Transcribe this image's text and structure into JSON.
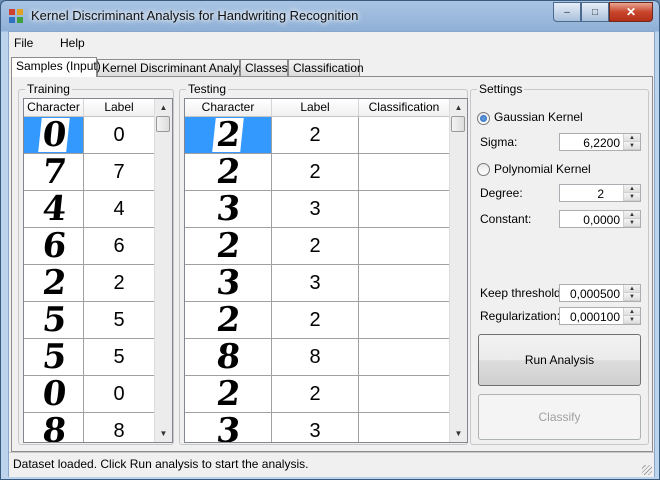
{
  "window": {
    "title": "Kernel Discriminant Analysis for Handwriting Recognition",
    "app_icon": "app-icon",
    "minimize": "–",
    "maximize": "□",
    "close": "✕"
  },
  "menu": {
    "file_label": "File",
    "help_label": "Help"
  },
  "tabs": [
    {
      "label": "Samples (Input)",
      "active": true
    },
    {
      "label": "Kernel Discriminant Analysis",
      "active": false
    },
    {
      "label": "Classes",
      "active": false
    },
    {
      "label": "Classification",
      "active": false
    }
  ],
  "training": {
    "title": "Training",
    "columns": [
      "Character",
      "Label"
    ],
    "rows": [
      {
        "character": "0",
        "label": "0"
      },
      {
        "character": "7",
        "label": "7"
      },
      {
        "character": "4",
        "label": "4"
      },
      {
        "character": "6",
        "label": "6"
      },
      {
        "character": "2",
        "label": "2"
      },
      {
        "character": "5",
        "label": "5"
      },
      {
        "character": "5",
        "label": "5"
      },
      {
        "character": "0",
        "label": "0"
      },
      {
        "character": "8",
        "label": "8"
      }
    ]
  },
  "testing": {
    "title": "Testing",
    "columns": [
      "Character",
      "Label",
      "Classification"
    ],
    "rows": [
      {
        "character": "2",
        "label": "2",
        "classification": ""
      },
      {
        "character": "2",
        "label": "2",
        "classification": ""
      },
      {
        "character": "3",
        "label": "3",
        "classification": ""
      },
      {
        "character": "2",
        "label": "2",
        "classification": ""
      },
      {
        "character": "3",
        "label": "3",
        "classification": ""
      },
      {
        "character": "2",
        "label": "2",
        "classification": ""
      },
      {
        "character": "8",
        "label": "8",
        "classification": ""
      },
      {
        "character": "2",
        "label": "2",
        "classification": ""
      },
      {
        "character": "3",
        "label": "3",
        "classification": ""
      }
    ]
  },
  "settings": {
    "title": "Settings",
    "gaussian_label": "Gaussian Kernel",
    "gaussian_selected": true,
    "sigma_label": "Sigma:",
    "sigma_value": "6,2200",
    "polynomial_label": "Polynomial Kernel",
    "polynomial_selected": false,
    "degree_label": "Degree:",
    "degree_value": "2",
    "constant_label": "Constant:",
    "constant_value": "0,0000",
    "keep_threshold_label": "Keep threshold:",
    "keep_threshold_value": "0,000500",
    "regularization_label": "Regularization:",
    "regularization_value": "0,000100",
    "run_button": "Run Analysis",
    "classify_button": "Classify"
  },
  "status": {
    "text": "Dataset loaded. Click Run analysis to start the analysis."
  },
  "colors": {
    "selection": "#3399ff",
    "title_bar": "#a9c4e3",
    "close_button": "#c8452c"
  }
}
